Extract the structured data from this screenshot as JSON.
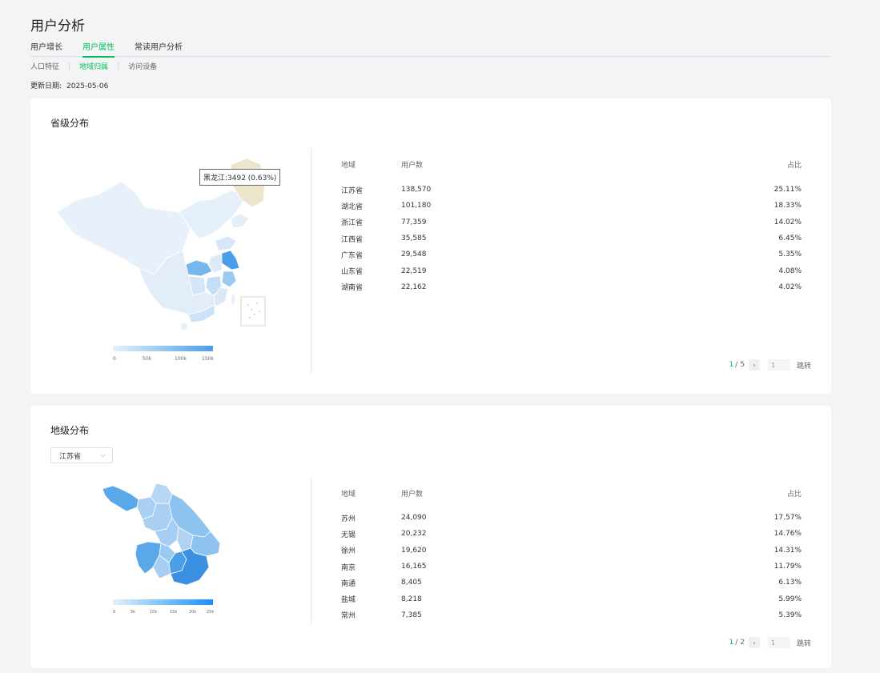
{
  "page": {
    "title": "用户分析"
  },
  "tabs": [
    {
      "label": "用户增长"
    },
    {
      "label": "用户属性"
    },
    {
      "label": "常读用户分析"
    }
  ],
  "subtabs": [
    {
      "label": "人口特征"
    },
    {
      "label": "地域归属"
    },
    {
      "label": "访问设备"
    }
  ],
  "update": {
    "label": "更新日期:",
    "value": "2025-05-06"
  },
  "province": {
    "title": "省级分布",
    "tooltip": "黑龙江:3492 (0.63%)",
    "legend_ticks": [
      "0",
      "50k",
      "100k",
      "150k"
    ],
    "columns": [
      "地域",
      "用户数",
      "占比"
    ],
    "rows": [
      {
        "region": "江苏省",
        "users": "138,570",
        "share": "25.11%"
      },
      {
        "region": "湖北省",
        "users": "101,180",
        "share": "18.33%"
      },
      {
        "region": "浙江省",
        "users": "77,359",
        "share": "14.02%"
      },
      {
        "region": "江西省",
        "users": "35,585",
        "share": "6.45%"
      },
      {
        "region": "广东省",
        "users": "29,548",
        "share": "5.35%"
      },
      {
        "region": "山东省",
        "users": "22,519",
        "share": "4.08%"
      },
      {
        "region": "湖南省",
        "users": "22,162",
        "share": "4.02%"
      }
    ],
    "pager": {
      "current": "1",
      "total": "5",
      "input": "1",
      "jump": "跳转"
    }
  },
  "city": {
    "title": "地级分布",
    "select_value": "江苏省",
    "legend_ticks": [
      "0",
      "5k",
      "10k",
      "15k",
      "20k",
      "25k"
    ],
    "columns": [
      "地域",
      "用户数",
      "占比"
    ],
    "rows": [
      {
        "region": "苏州",
        "users": "24,090",
        "share": "17.57%"
      },
      {
        "region": "无锡",
        "users": "20,232",
        "share": "14.76%"
      },
      {
        "region": "徐州",
        "users": "19,620",
        "share": "14.31%"
      },
      {
        "region": "南京",
        "users": "16,165",
        "share": "11.79%"
      },
      {
        "region": "南通",
        "users": "8,405",
        "share": "6.13%"
      },
      {
        "region": "盐城",
        "users": "8,218",
        "share": "5.99%"
      },
      {
        "region": "常州",
        "users": "7,385",
        "share": "5.39%"
      }
    ],
    "pager": {
      "current": "1",
      "total": "2",
      "input": "1",
      "jump": "跳转"
    }
  },
  "colors": {
    "accent": "#07c160",
    "map_high": "#4a9ee8",
    "map_low": "#e6f1fc",
    "highlight": "#ede4cc"
  }
}
